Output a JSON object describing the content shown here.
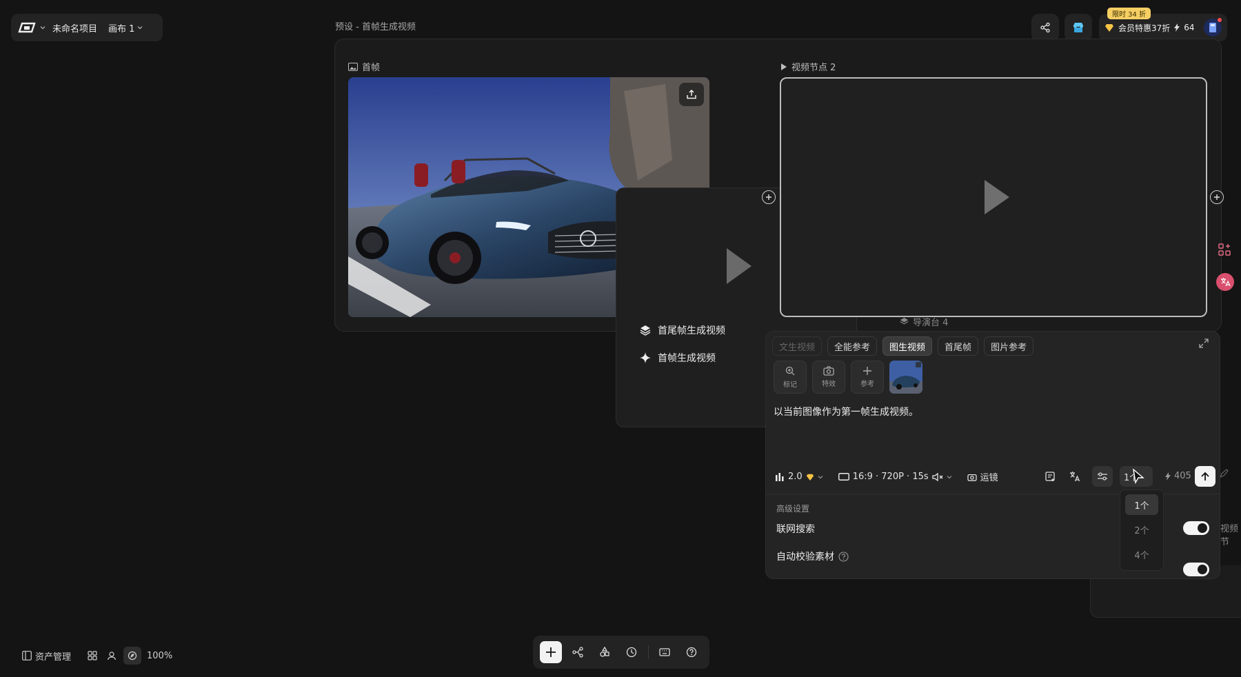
{
  "header": {
    "project_name": "未命名项目",
    "canvas_name": "画布 1",
    "promo_badge": "限时 34 折",
    "membership_text": "会员特惠37折",
    "credits": "64"
  },
  "preset": {
    "title": "预设 - 首帧生成视频",
    "first_frame_label": "首帧",
    "video_node_label": "视频节点 2",
    "director_label": "导演台 4",
    "menu_items": [
      "首尾帧生成视频",
      "首帧生成视频"
    ]
  },
  "generator": {
    "tabs": [
      {
        "label": "文生视频",
        "state": "disabled"
      },
      {
        "label": "全能参考",
        "state": "normal"
      },
      {
        "label": "图生视频",
        "state": "active"
      },
      {
        "label": "首尾帧",
        "state": "normal"
      },
      {
        "label": "图片参考",
        "state": "normal"
      }
    ],
    "tools": [
      {
        "label": "标记",
        "icon": "mark-icon"
      },
      {
        "label": "特效",
        "icon": "camera-icon"
      },
      {
        "label": "参考",
        "icon": "plus-icon"
      }
    ],
    "prompt": "以当前图像作为第一帧生成视频。",
    "model_version": "2.0",
    "video_spec": "16:9 · 720P · 15s",
    "camera_label": "运镜",
    "count_value": "1个",
    "cost": "405",
    "advanced_title": "高级设置",
    "settings": [
      {
        "label": "联网搜索",
        "enabled": true
      },
      {
        "label": "自动校验素材",
        "enabled": true
      }
    ],
    "count_options": [
      "1个",
      "2个",
      "4个"
    ],
    "side_label": "视频节"
  },
  "footer": {
    "assets_label": "资产管理",
    "zoom": "100%"
  },
  "colors": {
    "background": "#141414",
    "panel": "#242424",
    "promo": "#f6cf63",
    "accent_gold": "#f6c445"
  }
}
